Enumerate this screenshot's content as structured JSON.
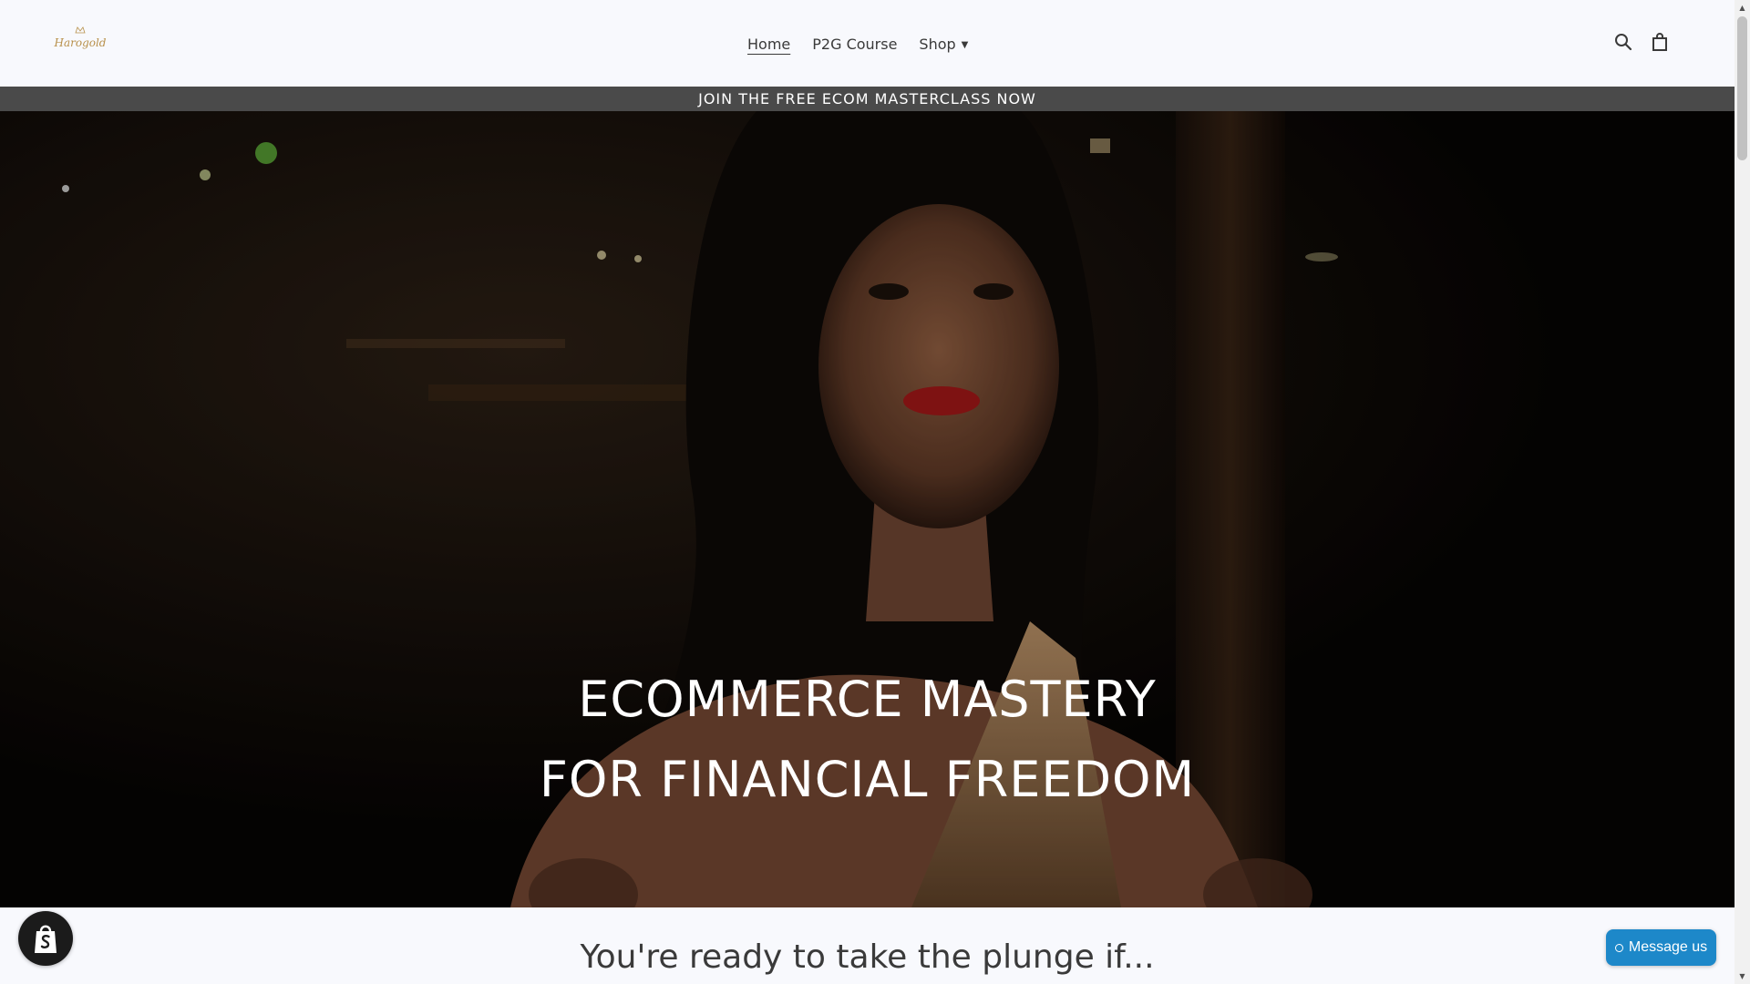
{
  "header": {
    "logo_text": "Harogold",
    "nav": [
      {
        "label": "Home",
        "active": true
      },
      {
        "label": "P2G Course",
        "active": false
      },
      {
        "label": "Shop",
        "active": false,
        "has_dropdown": true
      }
    ],
    "icons": [
      "search-icon",
      "cart-icon"
    ]
  },
  "announcement": {
    "text": "JOIN THE FREE ECOM MASTERCLASS NOW"
  },
  "hero": {
    "title_line1": "ECOMMERCE MASTERY",
    "title_line2": "FOR FINANCIAL FREEDOM"
  },
  "section": {
    "heading": "You're ready to take the plunge if..."
  },
  "widgets": {
    "shop_badge_icon": "shopify-bag-icon",
    "message_label": "Message us"
  },
  "colors": {
    "page_bg": "#f8f9fd",
    "announcement_bg": "#4a4a4a",
    "message_button": "#1d88c9",
    "logo_gold": "#b8904a"
  }
}
